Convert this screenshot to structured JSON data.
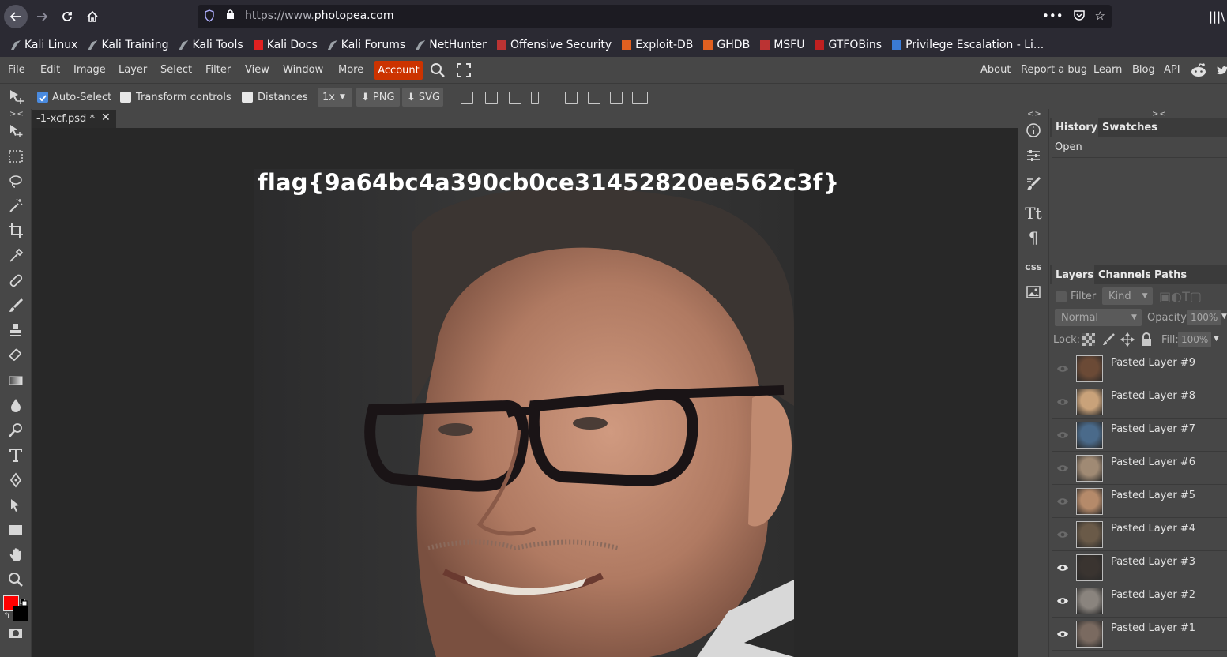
{
  "browser": {
    "url_prefix": "https://www.",
    "url_domain": "photopea.com",
    "bookmarks": [
      {
        "label": "Kali Linux",
        "icon": "kali-dragon-icon",
        "color": "#9aa0a6"
      },
      {
        "label": "Kali Training",
        "icon": "kali-dragon-icon",
        "color": "#9aa0a6"
      },
      {
        "label": "Kali Tools",
        "icon": "kali-dragon-icon",
        "color": "#9aa0a6"
      },
      {
        "label": "Kali Docs",
        "icon": "kali-docs-icon",
        "color": "#e02020"
      },
      {
        "label": "Kali Forums",
        "icon": "kali-dragon-icon",
        "color": "#9aa0a6"
      },
      {
        "label": "NetHunter",
        "icon": "kali-dragon-icon",
        "color": "#9aa0a6"
      },
      {
        "label": "Offensive Security",
        "icon": "offsec-icon",
        "color": "#b33"
      },
      {
        "label": "Exploit-DB",
        "icon": "exploitdb-icon",
        "color": "#e06020"
      },
      {
        "label": "GHDB",
        "icon": "exploitdb-icon",
        "color": "#e06020"
      },
      {
        "label": "MSFU",
        "icon": "offsec-icon",
        "color": "#b33"
      },
      {
        "label": "GTFOBins",
        "icon": "gtfobins-icon",
        "color": "#c02020"
      },
      {
        "label": "Privilege Escalation - Li...",
        "icon": "layers-blue-icon",
        "color": "#3a7bd5"
      }
    ]
  },
  "menu": {
    "items": [
      "File",
      "Edit",
      "Image",
      "Layer",
      "Select",
      "Filter",
      "View",
      "Window",
      "More"
    ],
    "account": "Account",
    "right_links": [
      "About",
      "Report a bug",
      "Learn",
      "Blog",
      "API"
    ]
  },
  "options": {
    "auto_select": "Auto-Select",
    "transform_controls": "Transform controls",
    "distances": "Distances",
    "zoom": "1x",
    "png": "PNG",
    "svg": "SVG"
  },
  "document": {
    "tab_title": "-1-xcf.psd *",
    "flag_text": "flag{9a64bc4a390cb0ce31452820ee562c3f}"
  },
  "history_panel": {
    "tabs": [
      "History",
      "Swatches"
    ],
    "entries": [
      "Open"
    ]
  },
  "layers_panel": {
    "tabs": [
      "Layers",
      "Channels",
      "Paths"
    ],
    "filter_label": "Filter",
    "kind_label": "Kind",
    "blend_mode": "Normal",
    "opacity_label": "Opacity:",
    "opacity_value": "100%",
    "lock_label": "Lock:",
    "fill_label": "Fill:",
    "fill_value": "100%",
    "layers": [
      {
        "name": "Pasted Layer #9",
        "visible": false,
        "thumb": "#6b4a36"
      },
      {
        "name": "Pasted Layer #8",
        "visible": false,
        "thumb": "#c9a27a"
      },
      {
        "name": "Pasted Layer #7",
        "visible": false,
        "thumb": "#4a6a8a"
      },
      {
        "name": "Pasted Layer #6",
        "visible": false,
        "thumb": "#a08a74"
      },
      {
        "name": "Pasted Layer #5",
        "visible": false,
        "thumb": "#b58a6a"
      },
      {
        "name": "Pasted Layer #4",
        "visible": false,
        "thumb": "#6a5a48"
      },
      {
        "name": "Pasted Layer #3",
        "visible": true,
        "thumb": "#3a3430"
      },
      {
        "name": "Pasted Layer #2",
        "visible": true,
        "thumb": "#8a847e"
      },
      {
        "name": "Pasted Layer #1",
        "visible": true,
        "thumb": "#7a6a60"
      }
    ]
  },
  "colors": {
    "foreground": "#ff0000",
    "background": "#000000",
    "account_button": "#cc3300"
  }
}
